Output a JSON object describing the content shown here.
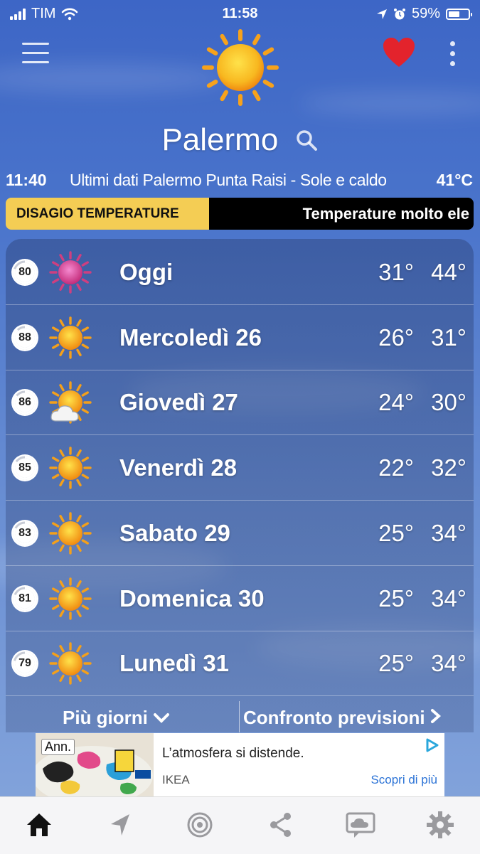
{
  "status_bar": {
    "carrier": "TIM",
    "time": "11:58",
    "battery": "59%",
    "battery_level": 0.59
  },
  "header": {
    "city": "Palermo"
  },
  "observation": {
    "time": "11:40",
    "description": "Ultimi dati Palermo Punta Raisi - Sole e caldo",
    "temperature": "41°C"
  },
  "alert": {
    "label": "DISAGIO TEMPERATURE",
    "message": "Temperature molto ele"
  },
  "forecast": [
    {
      "index": "80",
      "day": "Oggi",
      "min": "31°",
      "max": "44°",
      "icon": "hot-sun-icon"
    },
    {
      "index": "88",
      "day": "Mercoledì 26",
      "min": "26°",
      "max": "31°",
      "icon": "sun-icon"
    },
    {
      "index": "86",
      "day": "Giovedì 27",
      "min": "24°",
      "max": "30°",
      "icon": "sun-cloud-icon"
    },
    {
      "index": "85",
      "day": "Venerdì 28",
      "min": "22°",
      "max": "32°",
      "icon": "sun-icon"
    },
    {
      "index": "83",
      "day": "Sabato 29",
      "min": "25°",
      "max": "34°",
      "icon": "sun-icon"
    },
    {
      "index": "81",
      "day": "Domenica 30",
      "min": "25°",
      "max": "34°",
      "icon": "sun-icon"
    },
    {
      "index": "79",
      "day": "Lunedì 31",
      "min": "25°",
      "max": "34°",
      "icon": "sun-icon"
    }
  ],
  "more": {
    "more_days": "Più giorni",
    "compare": "Confronto previsioni"
  },
  "ad": {
    "badge": "Ann.",
    "headline": "L’atmosfera si distende.",
    "advertiser": "IKEA",
    "cta": "Scopri di più"
  },
  "colors": {
    "sky_top": "#3d66c6",
    "alert_yellow": "#f4cd54",
    "heart_red": "#e3232c",
    "link_blue": "#2a72d6",
    "sun_orange": "#f7a21b"
  },
  "tabs": [
    "home-icon",
    "location-arrow-icon",
    "radar-icon",
    "share-icon",
    "chat-cloud-icon",
    "gear-icon"
  ]
}
